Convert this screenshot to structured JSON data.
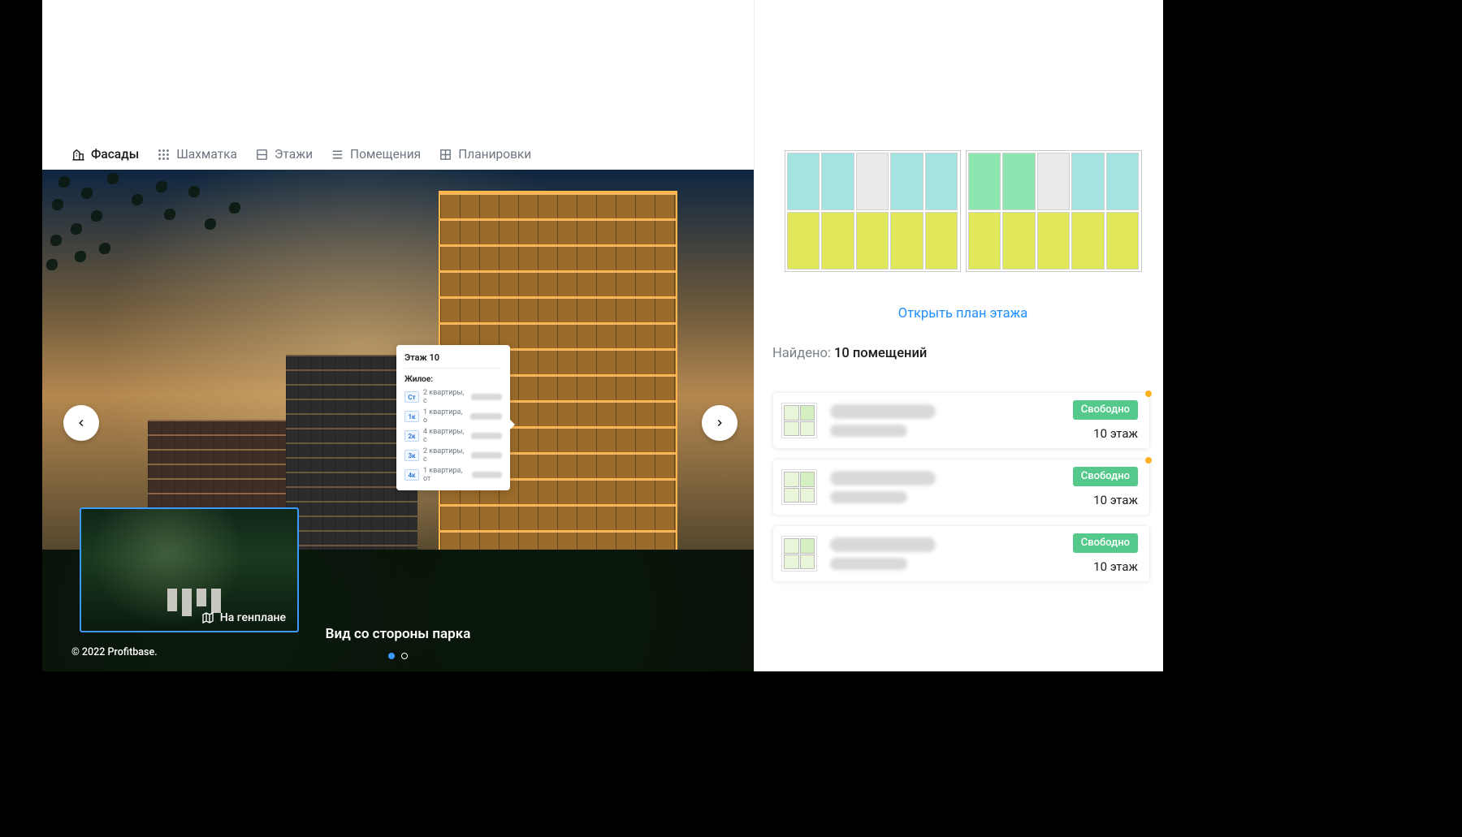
{
  "tabs": [
    {
      "label": "Фасады",
      "active": true
    },
    {
      "label": "Шахматка",
      "active": false
    },
    {
      "label": "Этажи",
      "active": false
    },
    {
      "label": "Помещения",
      "active": false
    },
    {
      "label": "Планировки",
      "active": false
    }
  ],
  "tooltip": {
    "title": "Этаж 10",
    "subtitle": "Жилое:",
    "rows": [
      {
        "badge": "Ст",
        "text": "2 квартиры, с"
      },
      {
        "badge": "1к",
        "text": "1 квартира, о"
      },
      {
        "badge": "2к",
        "text": "4 квартиры, с"
      },
      {
        "badge": "3к",
        "text": "2 квартиры, с"
      },
      {
        "badge": "4к",
        "text": "1 квартира, от"
      }
    ]
  },
  "genplan_label": "На генплане",
  "caption": "Вид со стороны парка",
  "copyright": "© 2022 Profitbase.",
  "slider": {
    "active_index": 0,
    "count": 2
  },
  "sidebar": {
    "open_plan_label": "Открыть план этажа",
    "found_prefix": "Найдено: ",
    "found_value": "10 помещений"
  },
  "listings": [
    {
      "status": "Свободно",
      "floor": "10 этаж",
      "hot": true
    },
    {
      "status": "Свободно",
      "floor": "10 этаж",
      "hot": true
    },
    {
      "status": "Свободно",
      "floor": "10 этаж",
      "hot": false
    }
  ]
}
